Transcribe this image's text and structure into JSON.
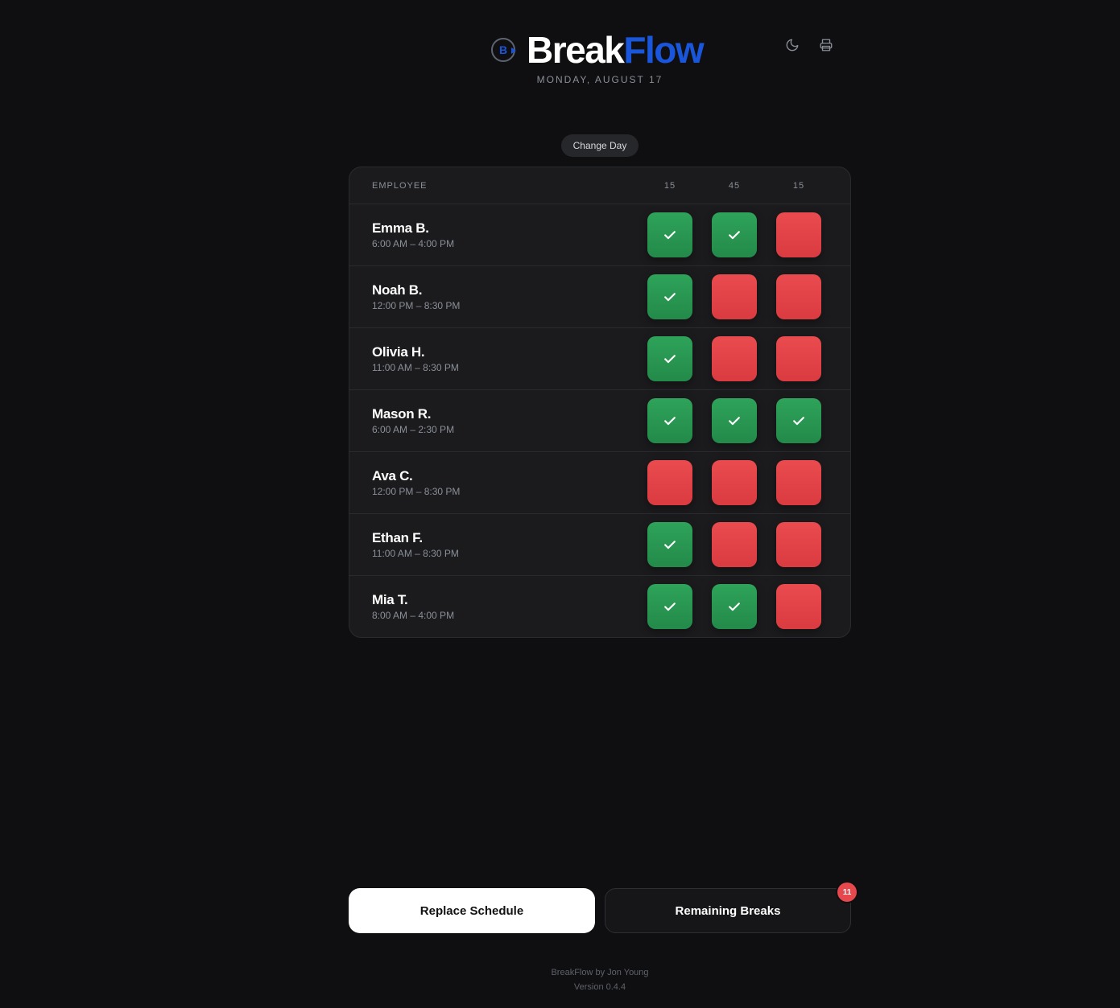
{
  "brand": {
    "name_part_a": "Break",
    "name_part_b": "Flow",
    "logo_letter": "B",
    "accent_color": "#1a56db"
  },
  "header": {
    "date": "MONDAY, AUGUST 17",
    "icons": [
      "moon-icon",
      "printer-icon"
    ]
  },
  "change_day_label": "Change Day",
  "table": {
    "employee_header": "EMPLOYEE",
    "break_headers": [
      "15",
      "45",
      "15"
    ],
    "rows": [
      {
        "name": "Emma B.",
        "hours": "6:00 AM – 4:00 PM",
        "breaks": [
          true,
          true,
          false
        ]
      },
      {
        "name": "Noah B.",
        "hours": "12:00 PM – 8:30 PM",
        "breaks": [
          true,
          false,
          false
        ]
      },
      {
        "name": "Olivia H.",
        "hours": "11:00 AM – 8:30 PM",
        "breaks": [
          true,
          false,
          false
        ]
      },
      {
        "name": "Mason R.",
        "hours": "6:00 AM – 2:30 PM",
        "breaks": [
          true,
          true,
          true
        ]
      },
      {
        "name": "Ava C.",
        "hours": "12:00 PM – 8:30 PM",
        "breaks": [
          false,
          false,
          false
        ]
      },
      {
        "name": "Ethan F.",
        "hours": "11:00 AM – 8:30 PM",
        "breaks": [
          true,
          false,
          false
        ]
      },
      {
        "name": "Mia T.",
        "hours": "8:00 AM – 4:00 PM",
        "breaks": [
          true,
          true,
          false
        ]
      }
    ]
  },
  "actions": {
    "replace_label": "Replace Schedule",
    "remaining_label": "Remaining Breaks",
    "remaining_count": "11"
  },
  "colors": {
    "done": "#2ea35a",
    "todo": "#e5484d",
    "background": "#0f0f11"
  },
  "footer": {
    "credit": "BreakFlow by Jon Young",
    "version": "Version 0.4.4"
  }
}
